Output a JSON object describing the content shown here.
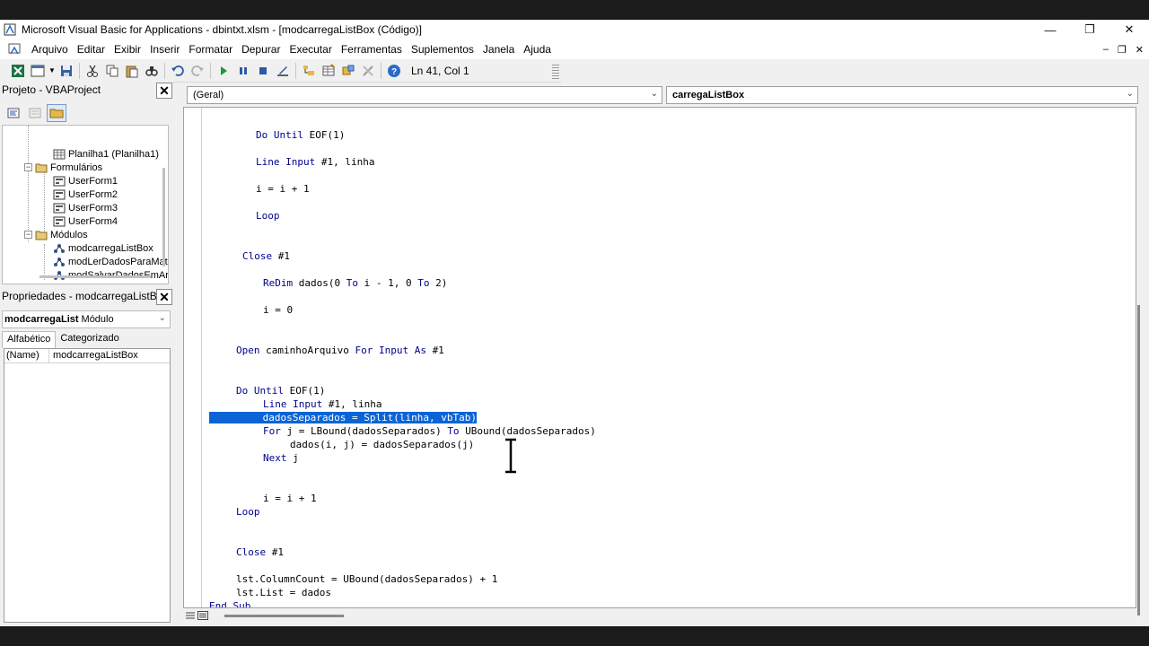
{
  "window": {
    "title": "Microsoft Visual Basic for Applications - dbintxt.xlsm - [modcarregaListBox (Código)]",
    "controls": {
      "minimize": "—",
      "restore": "❐",
      "close": "✕"
    }
  },
  "menubar": {
    "items": [
      {
        "label": "Arquivo"
      },
      {
        "label": "Editar"
      },
      {
        "label": "Exibir"
      },
      {
        "label": "Inserir"
      },
      {
        "label": "Formatar"
      },
      {
        "label": "Depurar"
      },
      {
        "label": "Executar"
      },
      {
        "label": "Ferramentas"
      },
      {
        "label": "Suplementos"
      },
      {
        "label": "Janela"
      },
      {
        "label": "Ajuda"
      }
    ],
    "mdi_controls": {
      "minimize": "‒",
      "restore": "❐",
      "close": "✕"
    }
  },
  "toolbar": {
    "status": "Ln 41, Col 1",
    "icons": [
      "excel-icon",
      "insert-userform-icon",
      "save-icon",
      "cut-icon",
      "copy-icon",
      "paste-icon",
      "find-icon",
      "undo-icon",
      "redo-icon",
      "run-icon",
      "break-icon",
      "reset-icon",
      "design-mode-icon",
      "project-explorer-icon",
      "properties-icon",
      "object-browser-icon",
      "toolbox-icon",
      "help-icon"
    ]
  },
  "project": {
    "title": "Projeto - VBAProject",
    "close": "✕",
    "tree": [
      {
        "label": "Planilha1 (Planilha1)",
        "kind": "sheet",
        "level": 2
      },
      {
        "label": "Formulários",
        "kind": "folder",
        "level": 1,
        "expander": "−"
      },
      {
        "label": "UserForm1",
        "kind": "form",
        "level": 2
      },
      {
        "label": "UserForm2",
        "kind": "form",
        "level": 2
      },
      {
        "label": "UserForm3",
        "kind": "form",
        "level": 2
      },
      {
        "label": "UserForm4",
        "kind": "form",
        "level": 2
      },
      {
        "label": "Módulos",
        "kind": "folder",
        "level": 1,
        "expander": "−"
      },
      {
        "label": "modcarregaListBox",
        "kind": "module",
        "level": 2
      },
      {
        "label": "modLerDadosParaMat",
        "kind": "module",
        "level": 2
      },
      {
        "label": "modSalvarDadosEmAr",
        "kind": "module",
        "level": 2
      }
    ]
  },
  "properties": {
    "title": "Propriedades - modcarregaListBox",
    "close": "✕",
    "object_name": "modcarregaList",
    "object_type": "Módulo",
    "tabs": [
      {
        "label": "Alfabético"
      },
      {
        "label": "Categorizado"
      }
    ],
    "rows": [
      {
        "key": "(Name)",
        "value": "modcarregaListBox"
      }
    ]
  },
  "code": {
    "object_combo": "(Geral)",
    "proc_combo": "carregaListBox",
    "lines": [
      {
        "segs": [
          {
            "t": "Do Until ",
            "kw": true
          },
          {
            "t": "EOF(1)"
          }
        ]
      },
      {
        "segs": [
          {
            "t": "Line Input ",
            "kw": true
          },
          {
            "t": "#1, linha"
          }
        ]
      },
      {
        "segs": [
          {
            "t": "i = i + 1"
          }
        ]
      },
      {
        "segs": [
          {
            "t": "Loop",
            "kw": true
          }
        ]
      },
      {
        "segs": [
          {
            "t": "Close ",
            "kw": true
          },
          {
            "t": "#1"
          }
        ]
      },
      {
        "segs": [
          {
            "t": "ReDim ",
            "kw": true
          },
          {
            "t": "dados(0 "
          },
          {
            "t": "To ",
            "kw": true
          },
          {
            "t": "i - 1, 0 "
          },
          {
            "t": "To ",
            "kw": true
          },
          {
            "t": "2)"
          }
        ]
      },
      {
        "segs": [
          {
            "t": "i = 0"
          }
        ]
      },
      {
        "segs": [
          {
            "t": "Open ",
            "kw": true
          },
          {
            "t": "caminhoArquivo "
          },
          {
            "t": "For Input As ",
            "kw": true
          },
          {
            "t": "#1"
          }
        ]
      },
      {
        "segs": [
          {
            "t": "Do Until ",
            "kw": true
          },
          {
            "t": "EOF(1)"
          }
        ]
      },
      {
        "segs": [
          {
            "t": "Line Input ",
            "kw": true
          },
          {
            "t": "#1, linha"
          }
        ]
      },
      {
        "segs": [
          {
            "t": "dadosSeparados = Split(linha, vbTab)"
          }
        ],
        "selected": true
      },
      {
        "segs": [
          {
            "t": "For ",
            "kw": true
          },
          {
            "t": "j = LBound(dadosSeparados) "
          },
          {
            "t": "To ",
            "kw": true
          },
          {
            "t": "UBound(dadosSeparados)"
          }
        ]
      },
      {
        "segs": [
          {
            "t": "dados(i, j) = dadosSeparados(j)"
          }
        ]
      },
      {
        "segs": [
          {
            "t": "Next ",
            "kw": true
          },
          {
            "t": "j"
          }
        ]
      },
      {
        "segs": [
          {
            "t": "i = i + 1"
          }
        ]
      },
      {
        "segs": [
          {
            "t": "Loop",
            "kw": true
          }
        ]
      },
      {
        "segs": [
          {
            "t": "Close ",
            "kw": true
          },
          {
            "t": "#1"
          }
        ]
      },
      {
        "segs": [
          {
            "t": "lst.ColumnCount = UBound(dadosSeparados) + 1"
          }
        ]
      },
      {
        "segs": [
          {
            "t": "lst.List = dados"
          }
        ]
      },
      {
        "segs": [
          {
            "t": "End Sub",
            "kw": true
          }
        ]
      }
    ]
  },
  "colors": {
    "keyword": "#00008b",
    "selection": "#0a64d6",
    "code_bg": "#ffffff",
    "chrome_bg": "#f0f0f0"
  }
}
